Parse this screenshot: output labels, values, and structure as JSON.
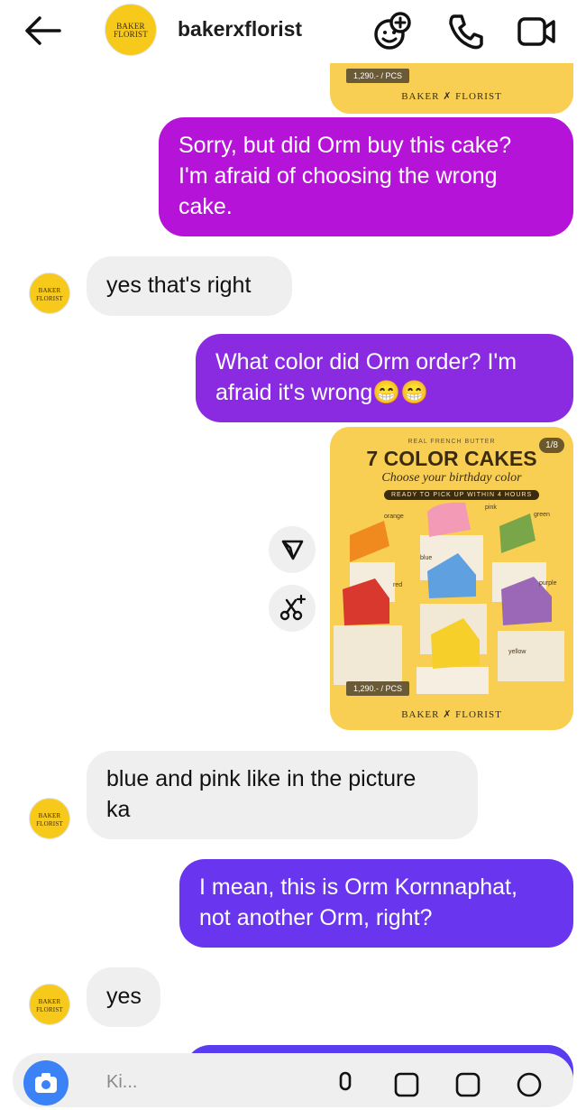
{
  "header": {
    "title": "bakerxflorist",
    "avatar_text": "BAKER FLORIST",
    "icons": [
      "back-arrow-icon",
      "sticker-face-icon",
      "phone-icon",
      "video-camera-icon"
    ]
  },
  "messages": {
    "prev_card_brand": "BAKER ✗ FLORIST",
    "prev_card_price": "1,290.- / PCS",
    "m1": [
      "Sorry, but did Orm buy this cake?",
      "I'm afraid of choosing the wrong",
      "cake."
    ],
    "m2": "yes that's right",
    "m3": [
      "What color did Orm order? I'm",
      "afraid it's wrong😁😁"
    ],
    "card": {
      "realfr": "REAL FRENCH BUTTER",
      "title": "7 COLOR CAKES",
      "subtitle": "Choose your birthday color",
      "pill": "READY TO PICK UP WITHIN 4 HOURS",
      "counter": "1/8",
      "price": "1,290.- / PCS",
      "brand": "BAKER ✗ FLORIST",
      "tags": [
        "orange",
        "pink",
        "green",
        "blue",
        "red",
        "purple",
        "yellow"
      ]
    },
    "m4": [
      "blue and pink like in the picture",
      "ka"
    ],
    "m5": [
      "I mean, this is Orm Kornnaphat,",
      "not another Orm, right?"
    ],
    "m6": "yes"
  },
  "composer": {
    "placeholder": "Ki...",
    "icons": [
      "camera-icon",
      "microphone-icon",
      "gallery-icon",
      "sticker-icon",
      "add-icon"
    ]
  },
  "colors": {
    "out_magenta": "#b514d8",
    "out_purple": "#8a2be2",
    "out_violet": "#6a35ee",
    "card_yellow": "#f9cf53",
    "accent_blue": "#3b82f6"
  }
}
